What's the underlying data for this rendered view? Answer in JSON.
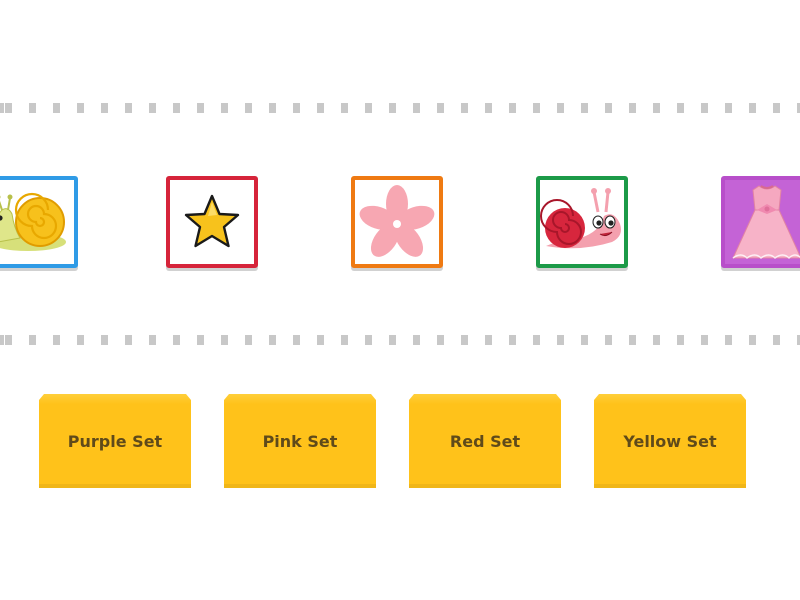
{
  "cards": [
    {
      "icon": "yellow-snail-icon",
      "border_color": "#2f9be6"
    },
    {
      "icon": "yellow-star-icon",
      "border_color": "#d6243a"
    },
    {
      "icon": "pink-flower-icon",
      "border_color": "#ef7a12"
    },
    {
      "icon": "red-snail-icon",
      "border_color": "#1c9a48"
    },
    {
      "icon": "pink-dress-icon",
      "border_color": "#b84fca"
    }
  ],
  "buckets": [
    {
      "label": "Purple Set"
    },
    {
      "label": "Pink Set"
    },
    {
      "label": "Red Set"
    },
    {
      "label": "Yellow Set"
    }
  ],
  "colors": {
    "bucket": "#ffc21a",
    "separator": "#c8c8c8"
  }
}
